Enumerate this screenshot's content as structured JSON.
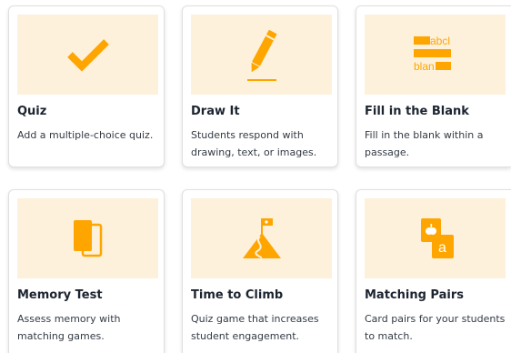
{
  "colors": {
    "accent": "#ffa500",
    "thumb_bg": "#fdf1dc",
    "title": "#1c2430",
    "text": "#333a44"
  },
  "cards": [
    {
      "title": "Quiz",
      "description": "Add a multiple-choice quiz.",
      "icon": "checkmark-icon"
    },
    {
      "title": "Draw It",
      "description": "Students respond with drawing, text, or images.",
      "icon": "pencil-icon"
    },
    {
      "title": "Fill in the Blank",
      "description": "Fill in the blank within a passage.",
      "icon": "fill-blank-icon",
      "icon_text": [
        "abcl",
        "blan"
      ]
    },
    {
      "title": "Memory Test",
      "description": "Assess memory with matching games.",
      "icon": "cards-icon"
    },
    {
      "title": "Time to Climb",
      "description": "Quiz game that increases student engagement.",
      "icon": "mountain-flag-icon"
    },
    {
      "title": "Matching Pairs",
      "description": "Card pairs for your students to match.",
      "icon": "matching-pairs-icon",
      "icon_text": "a"
    }
  ]
}
